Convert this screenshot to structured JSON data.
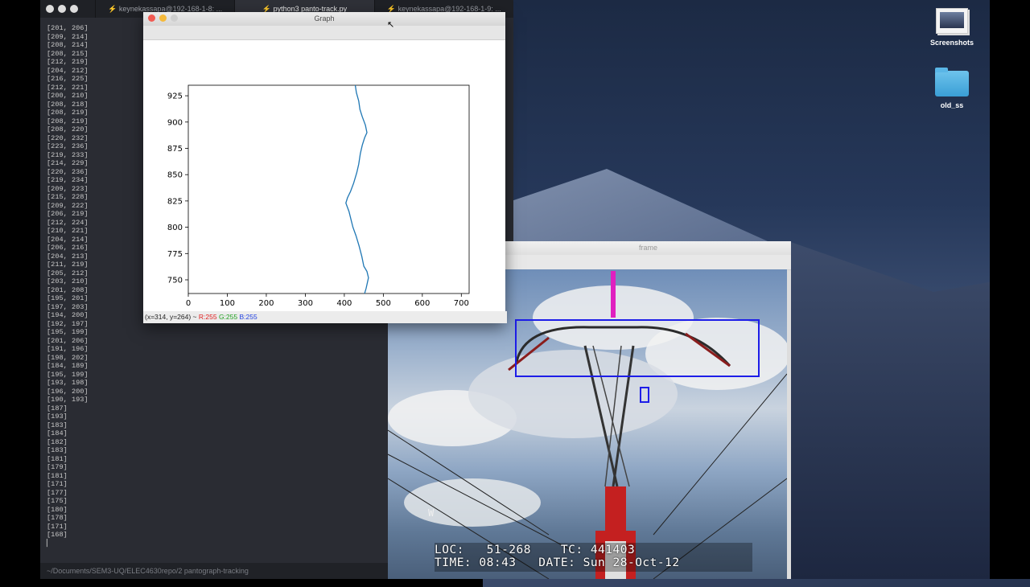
{
  "terminal": {
    "tabs": [
      "⚡ keynekassapa@192-168-1-8: ...",
      "⚡ python3 panto-track.py",
      "⚡ keynekassapa@192-168-1-9: ..."
    ],
    "output_lines": [
      "[201, 206]",
      "[209, 214]",
      "[208, 214]",
      "[208, 215]",
      "[212, 219]",
      "[204, 212]",
      "[216, 225]",
      "[212, 221]",
      "[200, 210]",
      "[208, 218]",
      "[208, 219]",
      "[208, 219]",
      "[208, 220]",
      "[220, 232]",
      "[223, 236]",
      "[219, 233]",
      "[214, 229]",
      "[220, 236]",
      "[219, 234]",
      "[209, 223]",
      "[215, 228]",
      "[209, 222]",
      "[206, 219]",
      "[212, 224]",
      "[210, 221]",
      "[204, 214]",
      "[206, 216]",
      "[204, 213]",
      "[211, 219]",
      "[205, 212]",
      "[203, 210]",
      "[201, 208]",
      "[195, 201]",
      "[197, 203]",
      "[194, 200]",
      "[192, 197]",
      "[195, 199]",
      "[201, 206]",
      "[191, 196]",
      "[198, 202]",
      "[184, 189]",
      "[195, 199]",
      "[193, 198]",
      "[196, 200]",
      "[190, 193]",
      "[187]",
      "[193]",
      "[183]",
      "[184]",
      "[182]",
      "[183]",
      "[181]",
      "[179]",
      "[181]",
      "[171]",
      "[177]",
      "[175]",
      "[180]",
      "[178]",
      "[171]",
      "[168]"
    ],
    "prompt_cursor": "▏",
    "status_path": "~/Documents/SEM3-UQ/ELEC4630repo/2 pantograph-tracking"
  },
  "graph_window": {
    "title": "Graph",
    "status": {
      "coords": "(x=314, y=264) ~ ",
      "r": "R:255",
      "g": "G:255",
      "b": "B:255"
    }
  },
  "chart_data": {
    "type": "line",
    "x_ticks": [
      "0",
      "100",
      "200",
      "300",
      "400",
      "500",
      "600",
      "700"
    ],
    "y_ticks": [
      "750",
      "775",
      "800",
      "825",
      "850",
      "875",
      "900",
      "925"
    ],
    "xlim": [
      0,
      720
    ],
    "ylim": [
      737,
      935
    ],
    "line_color": "#1f77b4",
    "series": [
      {
        "points": [
          [
            452,
            737
          ],
          [
            456,
            742
          ],
          [
            462,
            752
          ],
          [
            458,
            758
          ],
          [
            450,
            763
          ],
          [
            445,
            772
          ],
          [
            438,
            782
          ],
          [
            430,
            792
          ],
          [
            422,
            800
          ],
          [
            418,
            806
          ],
          [
            412,
            815
          ],
          [
            404,
            823
          ],
          [
            408,
            828
          ],
          [
            416,
            834
          ],
          [
            424,
            842
          ],
          [
            432,
            852
          ],
          [
            437,
            860
          ],
          [
            441,
            870
          ],
          [
            446,
            878
          ],
          [
            452,
            885
          ],
          [
            458,
            890
          ],
          [
            454,
            897
          ],
          [
            446,
            905
          ],
          [
            440,
            912
          ],
          [
            437,
            920
          ],
          [
            431,
            928
          ],
          [
            428,
            935
          ]
        ]
      }
    ]
  },
  "frame_window": {
    "title": "frame",
    "osd_line1": "LOC:   51-268    TC: 441403",
    "osd_line2": "TIME: 08:43   DATE: Sun 28-Oct-12",
    "watermark": "W",
    "box_color": "#1d1de8",
    "marker_color": "#e020c0"
  },
  "desktop": {
    "icons": [
      {
        "label": "Screenshots"
      },
      {
        "label": "old_ss"
      }
    ]
  }
}
